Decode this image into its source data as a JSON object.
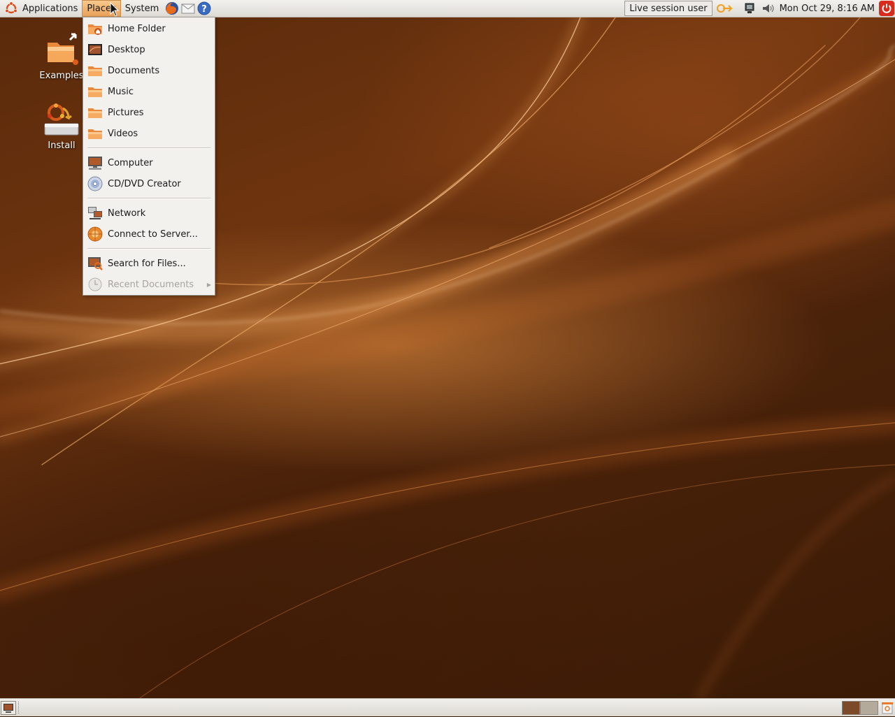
{
  "top_panel": {
    "menus": {
      "applications": "Applications",
      "places": "Places",
      "system": "System"
    },
    "session_user": "Live session user",
    "clock": "Mon Oct 29,  8:16 AM"
  },
  "desktop": {
    "icons": [
      {
        "label": "Examples"
      },
      {
        "label": "Install"
      }
    ]
  },
  "places_menu": {
    "items": [
      {
        "label": "Home Folder",
        "icon": "home-folder-icon"
      },
      {
        "label": "Desktop",
        "icon": "desktop-icon"
      },
      {
        "label": "Documents",
        "icon": "folder-icon"
      },
      {
        "label": "Music",
        "icon": "folder-icon"
      },
      {
        "label": "Pictures",
        "icon": "folder-icon"
      },
      {
        "label": "Videos",
        "icon": "folder-icon"
      },
      {
        "label": "Computer",
        "icon": "computer-icon"
      },
      {
        "label": "CD/DVD Creator",
        "icon": "cd-icon"
      },
      {
        "label": "Network",
        "icon": "network-icon"
      },
      {
        "label": "Connect to Server...",
        "icon": "server-icon"
      },
      {
        "label": "Search for Files...",
        "icon": "search-icon"
      },
      {
        "label": "Recent Documents",
        "icon": "clock-icon",
        "disabled": true
      }
    ]
  },
  "colors": {
    "accent": "#e9a15a",
    "wallpaper": "#5a2a0b",
    "panel": "#dedbd5"
  }
}
